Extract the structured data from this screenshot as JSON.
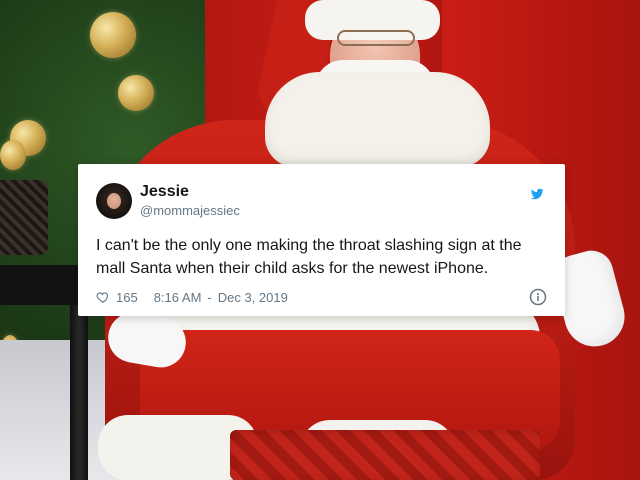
{
  "tweet": {
    "display_name": "Jessie",
    "handle": "@mommajessiec",
    "text": "I can't be the only one making the throat slashing sign at the mall Santa when their child asks for the newest iPhone.",
    "likes": "165",
    "time": "8:16 AM",
    "separator": "-",
    "date": "Dec 3, 2019"
  },
  "icons": {
    "twitter": "twitter-bird-icon",
    "heart": "heart-icon",
    "info": "info-icon"
  },
  "colors": {
    "twitter_blue": "#1DA1F2",
    "text_primary": "#14171A",
    "text_secondary": "#657786"
  }
}
